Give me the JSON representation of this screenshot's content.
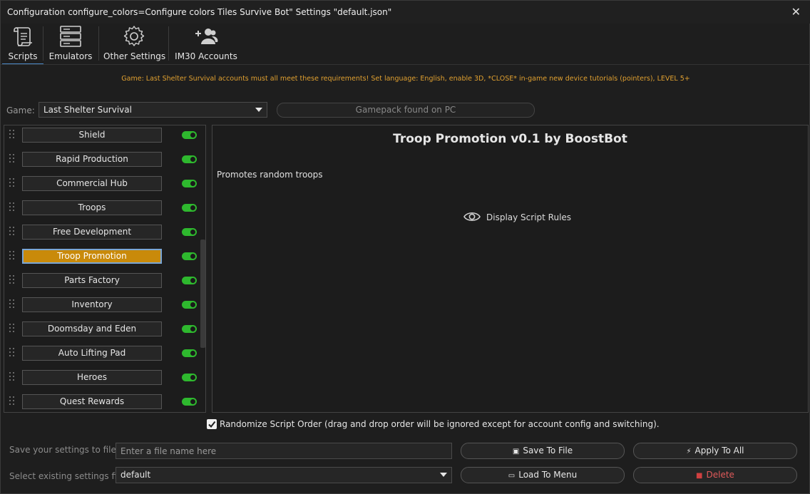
{
  "window": {
    "title": "Configuration configure_colors=Configure colors Tiles Survive Bot\" Settings \"default.json\"",
    "close_icon": "close-icon"
  },
  "tabs": [
    {
      "label": "Scripts",
      "icon": "scroll-icon",
      "active": true
    },
    {
      "label": "Emulators",
      "icon": "server-icon",
      "active": false
    },
    {
      "label": "Other Settings",
      "icon": "gear-icon",
      "active": false
    },
    {
      "label": "IM30 Accounts",
      "icon": "users-icon",
      "active": false
    }
  ],
  "notice": "Game: Last Shelter Survival accounts must all meet these requirements! Set language: English, enable 3D, *CLOSE* in-game new device tutorials (pointers), LEVEL 5+",
  "game": {
    "label": "Game:",
    "selected": "Last Shelter Survival",
    "gamepack_status": "Gamepack found on PC"
  },
  "scripts": [
    {
      "label": "Shield",
      "enabled": true,
      "selected": false
    },
    {
      "label": "Rapid Production",
      "enabled": true,
      "selected": false
    },
    {
      "label": "Commercial Hub",
      "enabled": true,
      "selected": false
    },
    {
      "label": "Troops",
      "enabled": true,
      "selected": false
    },
    {
      "label": "Free Development",
      "enabled": true,
      "selected": false
    },
    {
      "label": "Troop Promotion",
      "enabled": true,
      "selected": true
    },
    {
      "label": "Parts Factory",
      "enabled": true,
      "selected": false
    },
    {
      "label": "Inventory",
      "enabled": true,
      "selected": false
    },
    {
      "label": "Doomsday and Eden",
      "enabled": true,
      "selected": false
    },
    {
      "label": "Auto Lifting Pad",
      "enabled": true,
      "selected": false
    },
    {
      "label": "Heroes",
      "enabled": true,
      "selected": false
    },
    {
      "label": "Quest Rewards",
      "enabled": true,
      "selected": false
    }
  ],
  "detail": {
    "title": "Troop Promotion v0.1 by BoostBot",
    "description": "Promotes random troops",
    "rules_link": "Display Script Rules"
  },
  "randomize": {
    "checked": true,
    "label": "Randomize Script Order (drag and drop order will be ignored except for account config and switching)."
  },
  "save_row": {
    "label": "Save your settings to file",
    "placeholder": "Enter a file name here",
    "value": "",
    "save_button": "Save To File",
    "apply_button": "Apply To All"
  },
  "load_row": {
    "label": "Select existing settings file",
    "selected": "default",
    "load_button": "Load To Menu",
    "delete_button": "Delete"
  },
  "colors": {
    "background": "#1e1e1e",
    "accent_orange": "#c98a0a",
    "notice_text": "#e0a030",
    "toggle_on": "#2eb82e",
    "active_tab_underline": "#4a88c7",
    "danger": "#e05a5a"
  }
}
